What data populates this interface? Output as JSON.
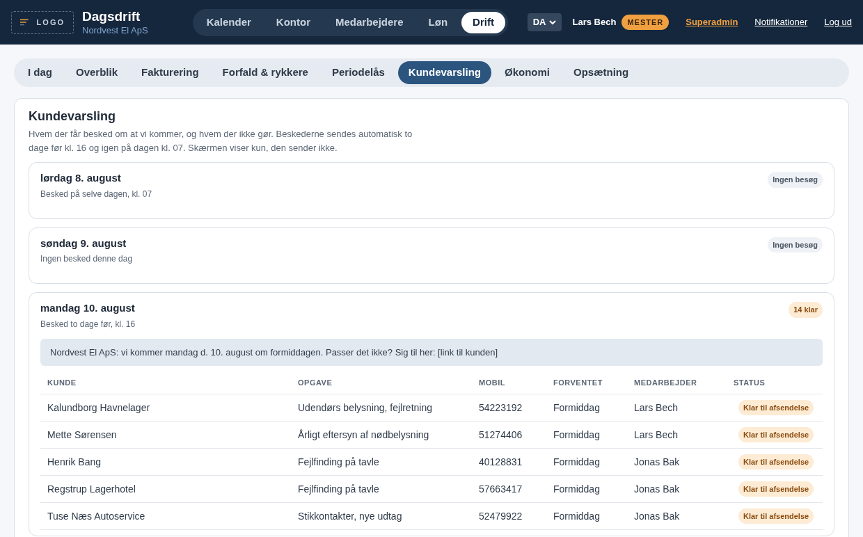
{
  "header": {
    "logo": "LOGO",
    "title": "Dagsdrift",
    "subtitle": "Nordvest El ApS",
    "nav": [
      {
        "label": "Kalender",
        "selected": false
      },
      {
        "label": "Kontor",
        "selected": false
      },
      {
        "label": "Medarbejdere",
        "selected": false
      },
      {
        "label": "Løn",
        "selected": false
      },
      {
        "label": "Drift",
        "selected": true
      }
    ],
    "language": "DA",
    "user": "Lars Bech",
    "role": "MESTER",
    "links": [
      {
        "label": "Superadmin",
        "kind": "accent"
      },
      {
        "label": "Notifikationer",
        "kind": "plain"
      },
      {
        "label": "Log ud",
        "kind": "plain"
      }
    ]
  },
  "tabs": [
    {
      "label": "I dag",
      "selected": false
    },
    {
      "label": "Overblik",
      "selected": false
    },
    {
      "label": "Fakturering",
      "selected": false
    },
    {
      "label": "Forfald & rykkere",
      "selected": false
    },
    {
      "label": "Periodelås",
      "selected": false
    },
    {
      "label": "Kundevarsling",
      "selected": true
    },
    {
      "label": "Økonomi",
      "selected": false
    },
    {
      "label": "Opsætning",
      "selected": false
    }
  ],
  "panel": {
    "title": "Kundevarsling",
    "description": "Hvem der får besked om at vi kommer, og hvem der ikke gør. Beskederne sendes automatisk to dage før kl. 16 og igen på dagen kl. 07. Skærmen viser kun, den sender ikke.",
    "days": [
      {
        "date": "lørdag 8. august",
        "note": "Besked på selve dagen, kl. 07",
        "badge": {
          "text": "Ingen besøg",
          "kind": "neutral"
        }
      },
      {
        "date": "søndag 9. august",
        "note": "Ingen besked denne dag",
        "badge": {
          "text": "Ingen besøg",
          "kind": "neutral"
        }
      },
      {
        "date": "mandag 10. august",
        "note": "Besked to dage før, kl. 16",
        "badge": {
          "text": "14 klar",
          "kind": "warning"
        },
        "message": "Nordvest El ApS: vi kommer mandag d. 10. august om formiddagen. Passer det ikke? Sig til her: [link til kunden]",
        "table": {
          "columns": [
            "KUNDE",
            "OPGAVE",
            "MOBIL",
            "FORVENTET",
            "MEDARBEJDER",
            "STATUS"
          ],
          "rows": [
            {
              "cells": [
                "Kalundborg Havnelager",
                "Udendørs belysning, fejlretning",
                "54223192",
                "Formiddag",
                "Lars Bech"
              ],
              "status": {
                "text": "Klar til afsendelse",
                "kind": "warning"
              }
            },
            {
              "cells": [
                "Mette Sørensen",
                "Årligt eftersyn af nødbelysning",
                "51274406",
                "Formiddag",
                "Lars Bech"
              ],
              "status": {
                "text": "Klar til afsendelse",
                "kind": "warning"
              }
            },
            {
              "cells": [
                "Henrik Bang",
                "Fejlfinding på tavle",
                "40128831",
                "Formiddag",
                "Jonas Bak"
              ],
              "status": {
                "text": "Klar til afsendelse",
                "kind": "warning"
              }
            },
            {
              "cells": [
                "Regstrup Lagerhotel",
                "Fejlfinding på tavle",
                "57663417",
                "Formiddag",
                "Jonas Bak"
              ],
              "status": {
                "text": "Klar til afsendelse",
                "kind": "warning"
              }
            },
            {
              "cells": [
                "Tuse Næs Autoservice",
                "Stikkontakter, nye udtag",
                "52479922",
                "Formiddag",
                "Jonas Bak"
              ],
              "status": {
                "text": "Klar til afsendelse",
                "kind": "warning"
              }
            }
          ]
        }
      }
    ]
  }
}
